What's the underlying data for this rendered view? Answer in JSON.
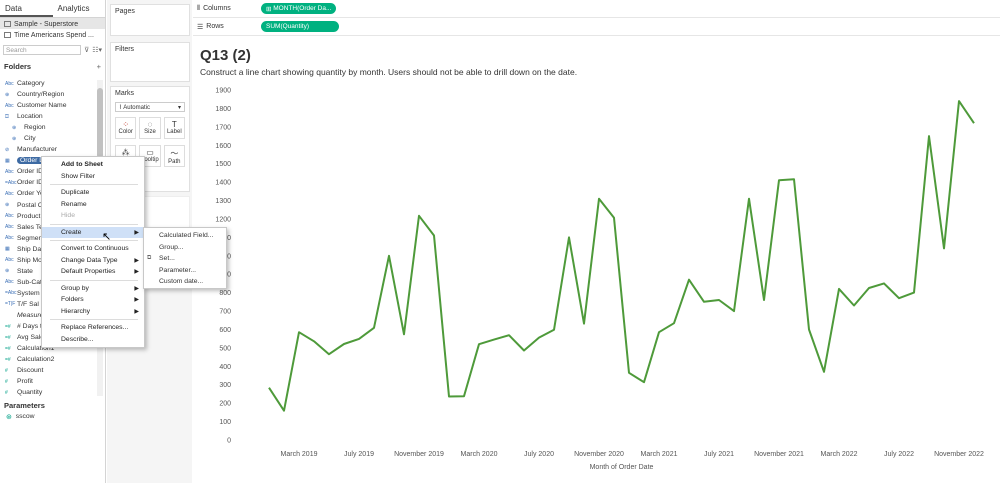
{
  "left_panel": {
    "tabs": [
      "Data",
      "Analytics"
    ],
    "datasources": [
      "Sample - Superstore",
      "Time Americans Spend ..."
    ],
    "search_placeholder": "Search",
    "folders_label": "Folders",
    "fields": [
      {
        "type": "Abc",
        "label": "Category"
      },
      {
        "type": "⊕",
        "label": "Country/Region"
      },
      {
        "type": "Abc",
        "label": "Customer Name"
      },
      {
        "type": "⛋",
        "label": "Location"
      },
      {
        "type": "⊕",
        "label": "Region",
        "sub": true
      },
      {
        "type": "⊕",
        "label": "City",
        "sub": true
      },
      {
        "type": "⊘",
        "label": "Manufacturer"
      },
      {
        "type": "▦",
        "label": "Order Date",
        "selected": true
      },
      {
        "type": "Abc",
        "label": "Order ID"
      },
      {
        "type": "=Abc",
        "label": "Order ID"
      },
      {
        "type": "Abc",
        "label": "Order Ye"
      },
      {
        "type": "⊕",
        "label": "Postal C"
      },
      {
        "type": "Abc",
        "label": "Product"
      },
      {
        "type": "Abc",
        "label": "Sales Te"
      },
      {
        "type": "Abc",
        "label": "Segmen"
      },
      {
        "type": "▦",
        "label": "Ship Da"
      },
      {
        "type": "Abc",
        "label": "Ship Mo"
      },
      {
        "type": "⊕",
        "label": "State"
      },
      {
        "type": "Abc",
        "label": "Sub-Cat"
      },
      {
        "type": "=Abc",
        "label": "System"
      },
      {
        "type": "=T|F",
        "label": "T/F Sal"
      },
      {
        "type": "",
        "label": "Measure",
        "italic": true
      },
      {
        "type": "=#",
        "label": "# Days t",
        "measure": true
      },
      {
        "type": "=#",
        "label": "Avg Sale",
        "measure": true
      },
      {
        "type": "=#",
        "label": "Calculation1",
        "measure": true
      },
      {
        "type": "=#",
        "label": "Calculation2",
        "measure": true
      },
      {
        "type": "#",
        "label": "Discount",
        "measure": true
      },
      {
        "type": "#",
        "label": "Profit",
        "measure": true
      },
      {
        "type": "#",
        "label": "Quantity",
        "measure": true
      }
    ],
    "parameters_label": "Parameters",
    "parameters": [
      "sscow"
    ]
  },
  "cards": {
    "pages": "Pages",
    "filters": "Filters",
    "marks": "Marks",
    "mark_type": "Automatic",
    "mark_buttons": [
      "Color",
      "Size",
      "Label"
    ],
    "mark_buttons2": [
      "",
      "Tooltip",
      "Path"
    ]
  },
  "shelves": {
    "columns_label": "Columns",
    "columns_pill": "MONTH(Order Da...",
    "rows_label": "Rows",
    "rows_pill": "SUM(Quantity)"
  },
  "sheet": {
    "title": "Q13 (2)",
    "subtitle": "Construct a line chart showing quantity by month.  Users should not be able to drill down on the date."
  },
  "context_menu": {
    "items": [
      {
        "label": "Add to Sheet",
        "bold": true
      },
      {
        "label": "Show Filter"
      },
      {
        "sep": true
      },
      {
        "label": "Duplicate"
      },
      {
        "label": "Rename"
      },
      {
        "label": "Hide",
        "disabled": true
      },
      {
        "sep": true
      },
      {
        "label": "Create",
        "arrow": true,
        "highlight": true
      },
      {
        "sep": true
      },
      {
        "label": "Convert to Continuous"
      },
      {
        "label": "Change Data Type",
        "arrow": true
      },
      {
        "label": "Default Properties",
        "arrow": true
      },
      {
        "sep": true
      },
      {
        "label": "Group by",
        "arrow": true
      },
      {
        "label": "Folders",
        "arrow": true
      },
      {
        "label": "Hierarchy",
        "arrow": true
      },
      {
        "sep": true
      },
      {
        "label": "Replace References..."
      },
      {
        "label": "Describe..."
      }
    ]
  },
  "submenu": {
    "items": [
      "Calculated Field...",
      "Group...",
      "Set...",
      "Parameter...",
      "Custom date..."
    ]
  },
  "chart_data": {
    "type": "line",
    "color": "#4e9a3a",
    "xlabel": "Month of Order Date",
    "ylabel": "",
    "ylim": [
      0,
      1900
    ],
    "yticks": [
      0,
      100,
      200,
      300,
      400,
      500,
      600,
      700,
      800,
      900,
      1000,
      1100,
      1200,
      1300,
      1400,
      1500,
      1600,
      1700,
      1800,
      1900
    ],
    "xtick_labels": [
      "March 2019",
      "July 2019",
      "November 2019",
      "March 2020",
      "July 2020",
      "November 2020",
      "March 2021",
      "July 2021",
      "November 2021",
      "March 2022",
      "July 2022",
      "November 2022"
    ],
    "x": [
      "Jan 2019",
      "Feb 2019",
      "Mar 2019",
      "Apr 2019",
      "May 2019",
      "Jun 2019",
      "Jul 2019",
      "Aug 2019",
      "Sep 2019",
      "Oct 2019",
      "Nov 2019",
      "Dec 2019",
      "Jan 2020",
      "Feb 2020",
      "Mar 2020",
      "Apr 2020",
      "May 2020",
      "Jun 2020",
      "Jul 2020",
      "Aug 2020",
      "Sep 2020",
      "Oct 2020",
      "Nov 2020",
      "Dec 2020",
      "Jan 2021",
      "Feb 2021",
      "Mar 2021",
      "Apr 2021",
      "May 2021",
      "Jun 2021",
      "Jul 2021",
      "Aug 2021",
      "Sep 2021",
      "Oct 2021",
      "Nov 2021",
      "Dec 2021",
      "Jan 2022",
      "Feb 2022",
      "Mar 2022",
      "Apr 2022",
      "May 2022",
      "Jun 2022",
      "Jul 2022",
      "Aug 2022",
      "Sep 2022",
      "Oct 2022",
      "Nov 2022",
      "Dec 2022"
    ],
    "values": [
      284,
      159,
      585,
      536,
      466,
      521,
      549,
      609,
      1000,
      574,
      1217,
      1110,
      236,
      238,
      520,
      545,
      569,
      486,
      556,
      598,
      1100,
      632,
      1310,
      1206,
      365,
      314,
      585,
      634,
      870,
      750,
      760,
      700,
      1310,
      760,
      1410,
      1416,
      600,
      370,
      820,
      730,
      825,
      850,
      770,
      800,
      1650,
      1040,
      1840,
      1720
    ]
  }
}
